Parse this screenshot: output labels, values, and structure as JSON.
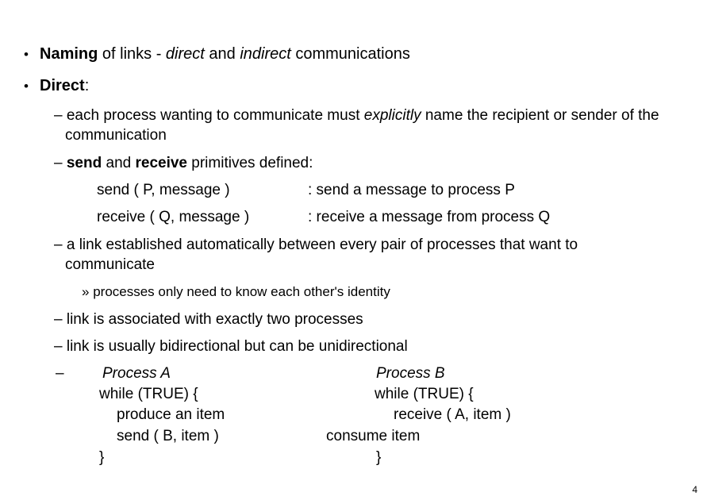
{
  "slide": {
    "page_number": "4",
    "background_color": "#ffffff",
    "text_color": "#000000",
    "bullets_level1": [
      {
        "marker": "•",
        "parts": [
          {
            "text": "Naming",
            "style": "bold"
          },
          {
            "text": " of links - ",
            "style": "normal"
          },
          {
            "text": "direct",
            "style": "italic"
          },
          {
            "text": " and ",
            "style": "normal"
          },
          {
            "text": "indirect",
            "style": "italic"
          },
          {
            "text": " communications",
            "style": "normal"
          }
        ],
        "plain": "Naming of links - direct and indirect communications"
      },
      {
        "marker": "•",
        "parts": [
          {
            "text": "Direct",
            "style": "bold"
          },
          {
            "text": ":",
            "style": "normal"
          }
        ],
        "plain": "Direct:"
      }
    ],
    "bullets_level2": [
      {
        "marker": "–",
        "parts": [
          {
            "text": "each process wanting to communicate must ",
            "style": "normal"
          },
          {
            "text": "explicitly",
            "style": "italic"
          },
          {
            "text": " name the recipient or sender of the communication",
            "style": "normal"
          }
        ],
        "plain": "each process wanting to communicate must explicitly name the recipient or sender of the communication"
      },
      {
        "marker": "–",
        "parts": [
          {
            "text": "send",
            "style": "bold"
          },
          {
            "text": " and ",
            "style": "normal"
          },
          {
            "text": "receive",
            "style": "bold"
          },
          {
            "text": " primitives defined:",
            "style": "normal"
          }
        ],
        "plain": "send and receive primitives defined:"
      },
      {
        "marker": "–",
        "parts": [
          {
            "text": "a link established automatically between every pair of processes that want to communicate",
            "style": "normal"
          }
        ],
        "plain": "a link established automatically between every pair of processes that want to communicate"
      },
      {
        "marker": "–",
        "parts": [
          {
            "text": "link is associated with exactly two processes",
            "style": "normal"
          }
        ],
        "plain": "link is associated with exactly two processes"
      },
      {
        "marker": "–",
        "parts": [
          {
            "text": "link is usually bidirectional but can be unidirectional",
            "style": "normal"
          }
        ],
        "plain": "link is usually bidirectional but can be unidirectional"
      }
    ],
    "bullets_level3": [
      {
        "marker": "»",
        "text": "processes only need to know each other's identity"
      }
    ],
    "primitives": [
      {
        "signature": "send ( P, message )",
        "description": ": send a message to process P"
      },
      {
        "signature": "receive ( Q, message )",
        "description": ": receive a message from process Q"
      }
    ],
    "process_block": {
      "marker": "–",
      "left_column": {
        "title": "Process A",
        "lines": [
          "while (TRUE) {",
          "produce an item",
          "send ( B, item )",
          "}"
        ]
      },
      "right_column": {
        "title": "Process B",
        "lines": [
          "while (TRUE) {",
          "receive ( A, item )",
          "consume item",
          "}"
        ]
      }
    }
  }
}
